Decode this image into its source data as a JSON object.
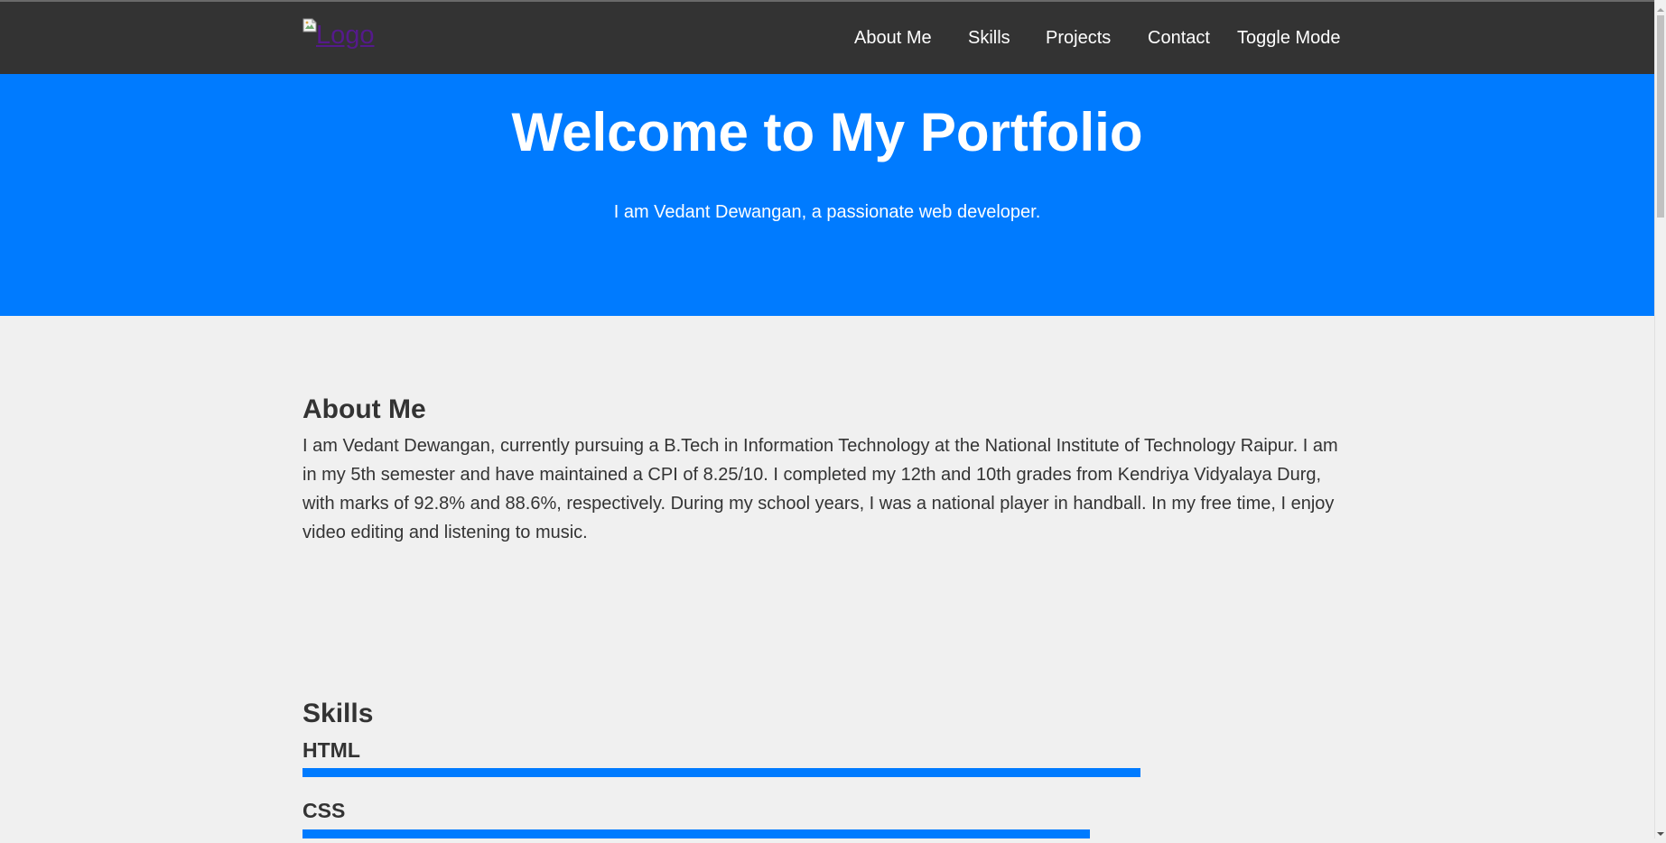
{
  "navbar": {
    "logo_alt": "Logo",
    "links": [
      {
        "label": "About Me"
      },
      {
        "label": "Skills"
      },
      {
        "label": "Projects"
      },
      {
        "label": "Contact"
      },
      {
        "label": "Toggle Mode"
      }
    ]
  },
  "hero": {
    "title": "Welcome to My Portfolio",
    "subtitle": "I am Vedant Dewangan, a passionate web developer."
  },
  "about": {
    "title": "About Me",
    "text": "I am Vedant Dewangan, currently pursuing a B.Tech in Information Technology at the National Institute of Technology Raipur. I am in my 5th semester and have maintained a CPI of 8.25/10. I completed my 12th and 10th grades from Kendriya Vidyalaya Durg, with marks of 92.8% and 88.6%, respectively. During my school years, I was a national player in handball. In my free time, I enjoy video editing and listening to music."
  },
  "skills": {
    "title": "Skills",
    "items": [
      {
        "name": "HTML",
        "level_fraction": 1.0
      },
      {
        "name": "CSS",
        "level_fraction": 0.94
      }
    ]
  },
  "colors": {
    "navbar_bg": "#333333",
    "accent": "#007bff",
    "page_bg": "#f0f0f0",
    "text": "#333333"
  },
  "icons": {
    "logo": "broken-image-icon"
  }
}
